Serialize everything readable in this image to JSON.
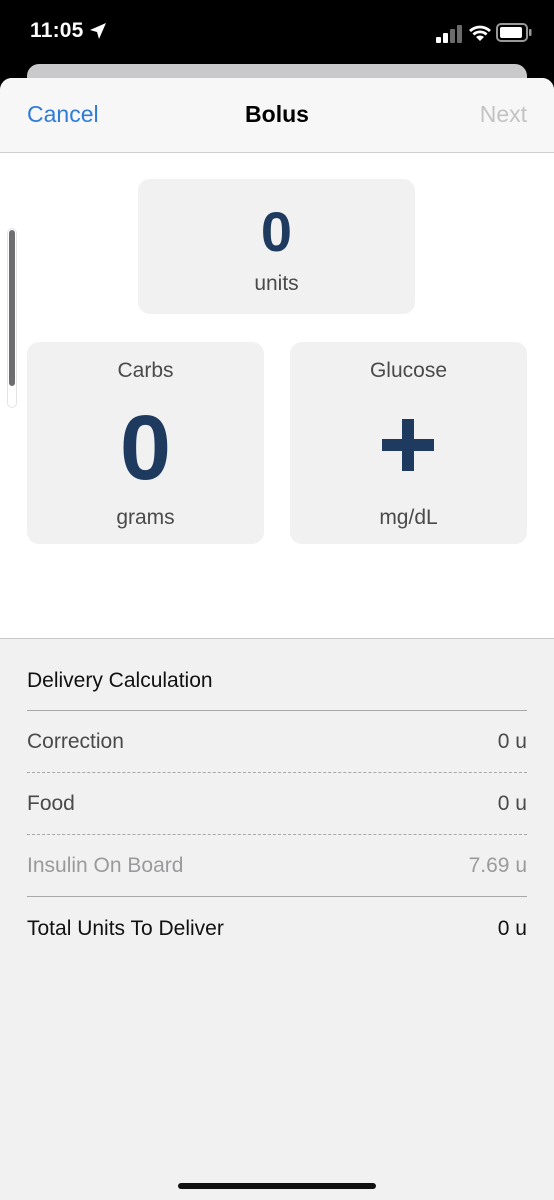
{
  "status": {
    "time": "11:05",
    "icons": [
      "location-arrow-icon",
      "cellular-signal-icon",
      "wifi-icon",
      "battery-icon"
    ]
  },
  "nav": {
    "cancel": "Cancel",
    "title": "Bolus",
    "next": "Next"
  },
  "bolus": {
    "units_value": "0",
    "units_label": "units"
  },
  "carbs": {
    "title": "Carbs",
    "value": "0",
    "unit": "grams"
  },
  "glucose": {
    "title": "Glucose",
    "icon": "plus-icon",
    "unit": "mg/dL"
  },
  "calculation": {
    "title": "Delivery Calculation",
    "rows": [
      {
        "label": "Correction",
        "value": "0 u"
      },
      {
        "label": "Food",
        "value": "0 u"
      },
      {
        "label": "Insulin On Board",
        "value": "7.69 u"
      }
    ],
    "total": {
      "label": "Total Units To Deliver",
      "value": "0 u"
    }
  },
  "colors": {
    "accent": "#2f7bd9",
    "value_text": "#1e3a5f",
    "tile_bg": "#f1f1f2"
  }
}
